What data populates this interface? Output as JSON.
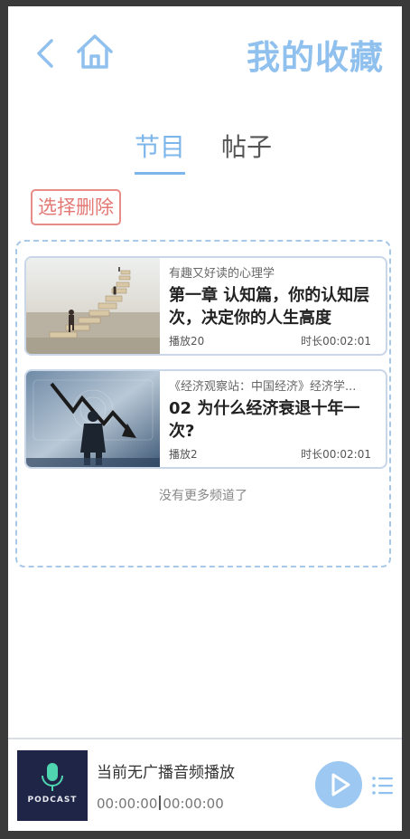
{
  "header": {
    "title": "我的收藏",
    "back_icon": "chevron-left-icon",
    "home_icon": "home-icon",
    "accent_color": "#8fc0ee"
  },
  "tabs": [
    {
      "label": "节目",
      "active": true
    },
    {
      "label": "帖子",
      "active": false
    }
  ],
  "select_delete_label": "选择删除",
  "items": [
    {
      "album": "有趣又好读的心理学",
      "title": "第一章 认知篇，你的认知层次，决定你的人生高度",
      "plays": "播放20",
      "duration": "时长00:02:01"
    },
    {
      "album": "《经济观察站：中国经济》经济学...",
      "title": "02 为什么经济衰退十年一次?",
      "plays": "播放2",
      "duration": "时长00:02:01"
    }
  ],
  "no_more_text": "没有更多频道了",
  "player": {
    "status": "当前无广播音频播放",
    "current_time": "00:00:00",
    "total_time": "00:00:00",
    "cover_text": "PODCAST"
  }
}
